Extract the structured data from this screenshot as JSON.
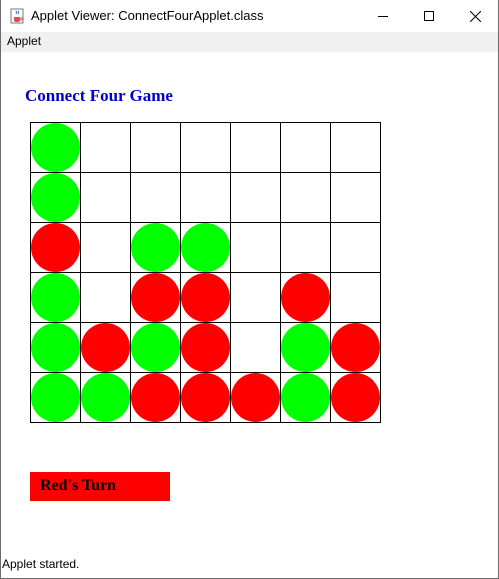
{
  "window": {
    "title": "Applet Viewer: ConnectFourApplet.class",
    "icon": "java-coffee-icon",
    "controls": [
      "minimize-icon",
      "maximize-icon",
      "close-icon"
    ]
  },
  "menubar": {
    "items": [
      {
        "label": "Applet"
      }
    ]
  },
  "game": {
    "title": "Connect Four Game",
    "turn_label": "Red's Turn",
    "colors": {
      "title": "#0000cc",
      "red": "#ff0000",
      "green": "#00ff00",
      "grid": "#000000",
      "banner": "#ff0000"
    },
    "board": {
      "columns": 7,
      "rows": 6,
      "cells": [
        [
          "G",
          "",
          "",
          "",
          "",
          "",
          ""
        ],
        [
          "G",
          "",
          "",
          "",
          "",
          "",
          ""
        ],
        [
          "R",
          "",
          "G",
          "G",
          "",
          "",
          ""
        ],
        [
          "G",
          "",
          "R",
          "R",
          "",
          "R",
          ""
        ],
        [
          "G",
          "R",
          "G",
          "R",
          "",
          "G",
          "R"
        ],
        [
          "G",
          "G",
          "R",
          "R",
          "R",
          "G",
          "R"
        ]
      ]
    }
  },
  "status": {
    "text": "Applet started."
  }
}
